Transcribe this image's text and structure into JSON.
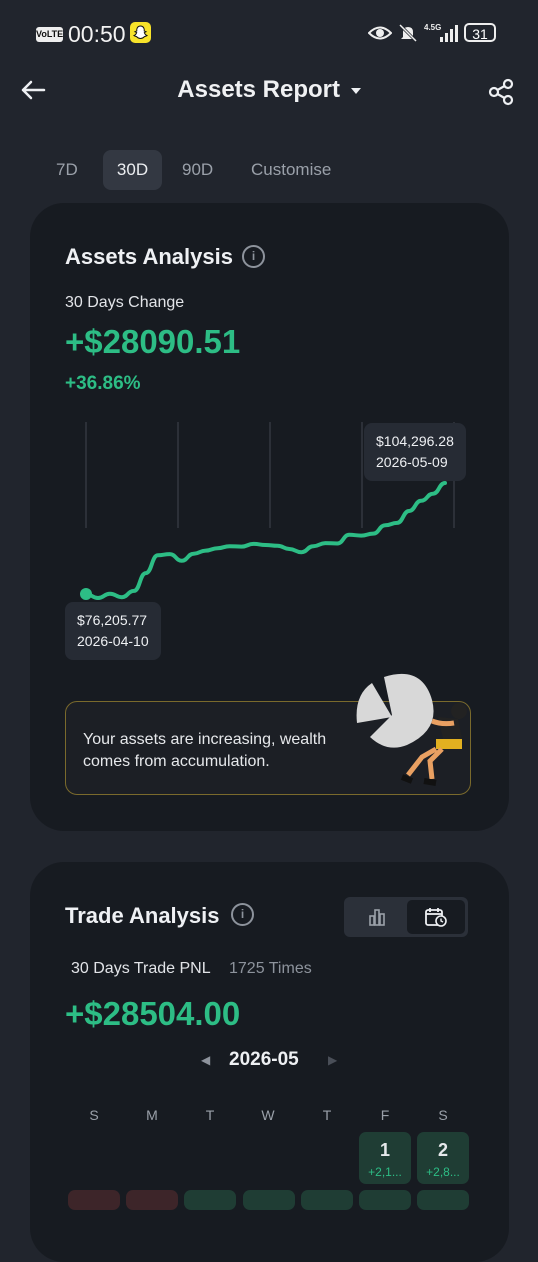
{
  "status_bar": {
    "volte": "VoLTE",
    "time": "00:50",
    "network": "4.5G",
    "battery": "31"
  },
  "header": {
    "title": "Assets Report",
    "dropdown_icon": "caret-down-icon",
    "back_icon": "back-arrow-icon",
    "share_icon": "share-icon"
  },
  "tabs": [
    {
      "label": "7D",
      "active": false
    },
    {
      "label": "30D",
      "active": true
    },
    {
      "label": "90D",
      "active": false
    },
    {
      "label": "Customise",
      "active": false
    }
  ],
  "assets": {
    "title": "Assets Analysis",
    "change_label": "30 Days Change",
    "change_value": "+$28090.51",
    "change_pct": "+36.86%",
    "high_tip": {
      "value": "$104,296.28",
      "date": "2026-05-09"
    },
    "low_tip": {
      "value": "$76,205.77",
      "date": "2026-04-10"
    },
    "message": "Your assets are increasing, wealth comes from accumulation."
  },
  "chart_data": {
    "type": "line",
    "series": [
      {
        "values": [
          76205.77,
          75200,
          76300,
          75400,
          77000,
          81500,
          86000,
          86300,
          84600,
          86400,
          87200,
          87800,
          88300,
          88200,
          88900,
          88600,
          88400,
          87600,
          86800,
          88300,
          89100,
          89000,
          91200,
          91000,
          91500,
          93600,
          94200,
          97200,
          99800,
          101600,
          104296.28
        ]
      }
    ],
    "x_range": [
      "2026-04-10",
      "2026-05-09"
    ],
    "grid": false
  },
  "trade": {
    "title": "Trade Analysis",
    "pnl_label": "30 Days Trade PNL",
    "times": "1725 Times",
    "pnl_value": "+$28504.00",
    "month": "2026-05",
    "weekdays": [
      "S",
      "M",
      "T",
      "W",
      "T",
      "F",
      "S"
    ],
    "days": [
      {
        "num": "1",
        "value": "+2,1..."
      },
      {
        "num": "2",
        "value": "+2,8..."
      }
    ]
  },
  "colors": {
    "accent_green": "#2dbd85",
    "card_bg": "#171b21",
    "page_bg": "#21252d",
    "banner_border": "#7a6a2c"
  }
}
